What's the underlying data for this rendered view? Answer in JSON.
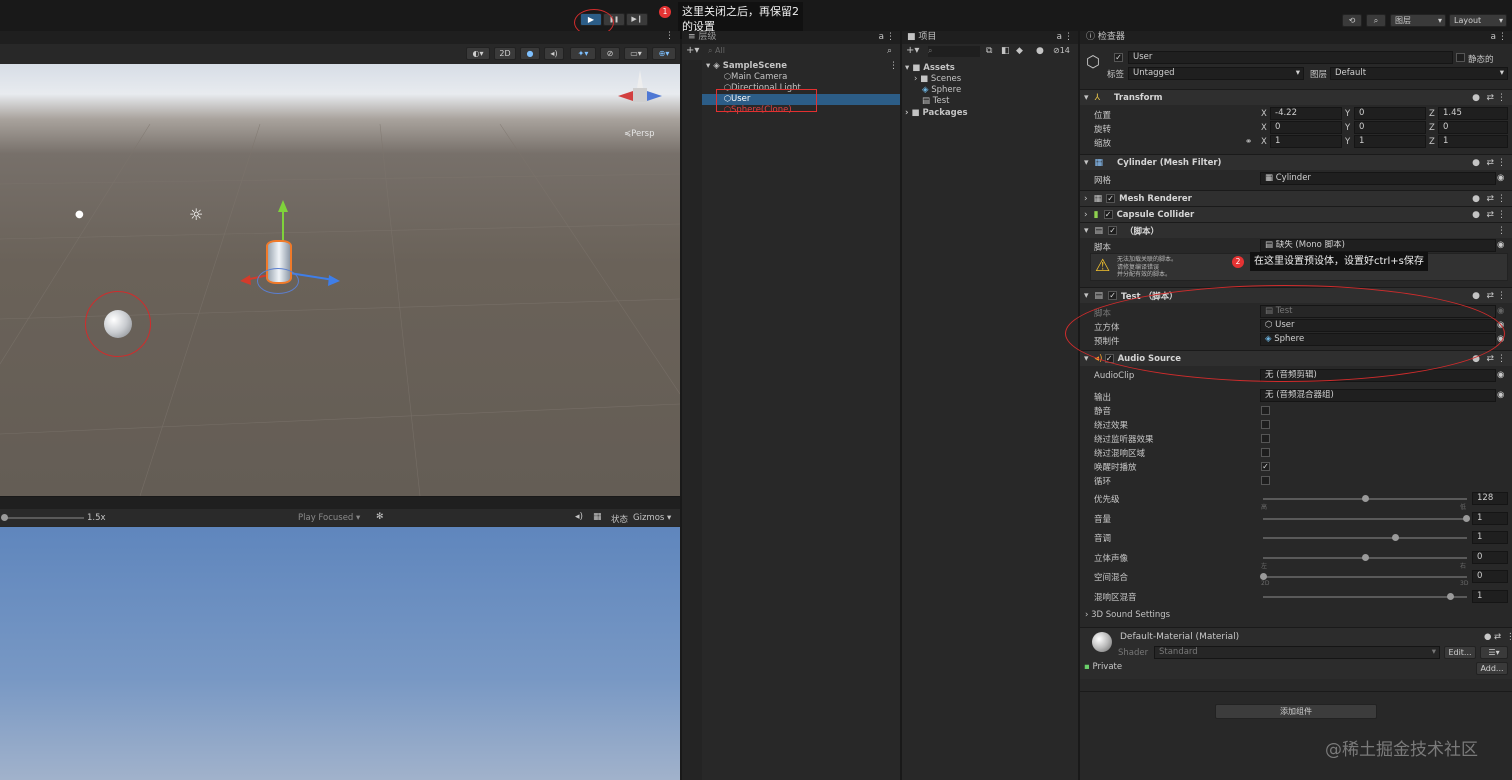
{
  "toolbar": {
    "layers": "图层",
    "layout": "Layout",
    "play_icon": "▶",
    "pause_icon": "❚❚",
    "step_icon": "▶❙"
  },
  "scene": {
    "toggle_2d": "2D",
    "persp_label": "≼Persp"
  },
  "game": {
    "scale": "1.5x",
    "play_focused": "Play Focused",
    "stats": "状态",
    "gizmos": "Gizmos"
  },
  "hierarchy": {
    "title": "层级",
    "search_placeholder": "All",
    "scene_name": "SampleScene",
    "items": [
      "Main Camera",
      "Directional Light",
      "User",
      "Sphere(Clone)"
    ]
  },
  "project": {
    "title": "项目",
    "count": "14",
    "assets": "Assets",
    "children": [
      "Scenes",
      "Sphere",
      "Test"
    ],
    "packages": "Packages"
  },
  "inspector": {
    "title": "检查器",
    "object_name": "User",
    "static_label": "静态的",
    "tag_label": "标签",
    "tag_value": "Untagged",
    "layer_label": "图层",
    "layer_value": "Default",
    "transform": {
      "title": "Transform",
      "position_label": "位置",
      "rotation_label": "旋转",
      "scale_label": "缩放",
      "axes": [
        "X",
        "Y",
        "Z"
      ],
      "position": [
        "-4.22",
        "0",
        "1.45"
      ],
      "rotation": [
        "0",
        "0",
        "0"
      ],
      "scale": [
        "1",
        "1",
        "1"
      ]
    },
    "mesh_filter": {
      "title": "Cylinder (Mesh Filter)",
      "mesh_label": "网格",
      "mesh_value": "Cylinder"
    },
    "mesh_renderer": {
      "title": "Mesh Renderer"
    },
    "capsule_collider": {
      "title": "Capsule Collider"
    },
    "missing_script": {
      "title": "（脚本）",
      "script_label": "脚本",
      "script_value": "缺失 (Mono 脚本)",
      "warning_lines": [
        "无法加载关联的脚本。",
        "请修复编译错误",
        "并分配有效的脚本。"
      ]
    },
    "test_component": {
      "title": "Test （脚本）",
      "script_label": "脚本",
      "script_value": "Test",
      "cube_label": "立方体",
      "cube_value": "User",
      "prefab_label": "预制件",
      "prefab_value": "Sphere"
    },
    "audio": {
      "title": "Audio Source",
      "clip_label": "AudioClip",
      "clip_value": "无 (音频剪辑)",
      "output_label": "输出",
      "output_value": "无 (音频混合器组)",
      "toggles": [
        {
          "label": "静音",
          "checked": false
        },
        {
          "label": "绕过效果",
          "checked": false
        },
        {
          "label": "绕过监听器效果",
          "checked": false
        },
        {
          "label": "绕过混响区域",
          "checked": false
        },
        {
          "label": "唤醒时播放",
          "checked": true
        },
        {
          "label": "循环",
          "checked": false
        }
      ],
      "sliders": [
        {
          "label": "优先级",
          "value": "128",
          "frac": 0.5,
          "min": "高",
          "max": "低"
        },
        {
          "label": "音量",
          "value": "1",
          "frac": 1.0
        },
        {
          "label": "音调",
          "value": "1",
          "frac": 0.65
        },
        {
          "label": "立体声像",
          "value": "0",
          "frac": 0.5,
          "min": "左",
          "max": "右"
        },
        {
          "label": "空间混合",
          "value": "0",
          "frac": 0.0,
          "min": "2D",
          "max": "3D"
        },
        {
          "label": "混响区混音",
          "value": "1",
          "frac": 0.92
        }
      ],
      "sound3d": "3D Sound Settings"
    },
    "material": {
      "name": "Default-Material (Material)",
      "shader_label": "Shader",
      "shader_value": "Standard",
      "edit": "Edit...",
      "private": "Private",
      "add": "Add..."
    },
    "add_component": "添加组件"
  },
  "annotations": {
    "tip1_badge": "1",
    "tip1": "这里关闭之后，再保留2的设置",
    "tip2_badge": "2",
    "tip2": "在这里设置预设体，设置好ctrl+s保存"
  },
  "watermark": "@稀土掘金技术社区",
  "colors": {
    "accent": "#2c5d87",
    "annotation_red": "#e23030",
    "sky_top": "#5f86bd",
    "ground": "#6a6259"
  }
}
